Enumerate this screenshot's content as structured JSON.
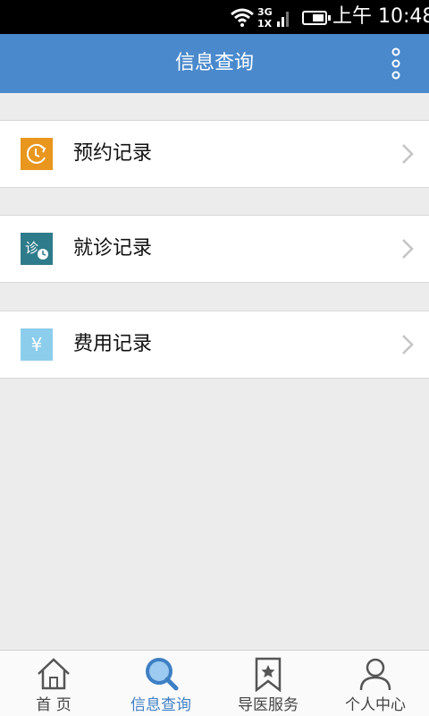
{
  "status_bar": {
    "network": "3G 1X",
    "network_3g": "3G",
    "network_1x": "1X",
    "time": "上午 10:48"
  },
  "header": {
    "title": "信息查询"
  },
  "menu": [
    {
      "label": "预约记录",
      "icon": "clock-refresh-icon",
      "icon_color": "#e8961e"
    },
    {
      "label": "就诊记录",
      "icon": "diagnosis-clock-icon",
      "icon_color": "#2e7b8b",
      "icon_text": "诊"
    },
    {
      "label": "费用记录",
      "icon": "yuan-icon",
      "icon_color": "#8dcdec",
      "icon_text": "¥"
    }
  ],
  "tabs": [
    {
      "label": "首 页",
      "icon": "home-icon",
      "active": false
    },
    {
      "label": "信息查询",
      "icon": "search-icon",
      "active": true
    },
    {
      "label": "导医服务",
      "icon": "bookmark-star-icon",
      "active": false
    },
    {
      "label": "个人中心",
      "icon": "person-icon",
      "active": false
    }
  ],
  "colors": {
    "header": "#4a89cc",
    "active_tab": "#3e7fc4",
    "background": "#ececec"
  }
}
